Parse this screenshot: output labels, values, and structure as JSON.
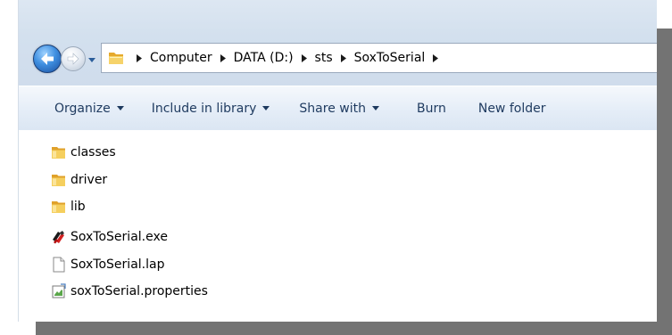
{
  "navigation": {
    "back_icon": "back-arrow-icon",
    "forward_icon": "forward-arrow-icon",
    "recent_pages_icon": "chevron-down-icon"
  },
  "address": {
    "root_icon": "folder-icon",
    "crumbs": [
      "Computer",
      "DATA (D:)",
      "sts",
      "SoxToSerial"
    ]
  },
  "toolbar": {
    "organize": "Organize",
    "include_in_library": "Include in library",
    "share_with": "Share with",
    "burn": "Burn",
    "new_folder": "New folder"
  },
  "files": [
    {
      "name": "classes",
      "icon": "folder-icon"
    },
    {
      "name": "driver",
      "icon": "folder-icon"
    },
    {
      "name": "lib",
      "icon": "folder-icon"
    },
    {
      "name": "SoxToSerial.exe",
      "icon": "exe-app-icon"
    },
    {
      "name": "SoxToSerial.lap",
      "icon": "blank-file-icon"
    },
    {
      "name": "soxToSerial.properties",
      "icon": "properties-file-icon"
    }
  ],
  "colors": {
    "shadow": "#737373",
    "chrome": "#d3e0ee",
    "folder_yellow": "#f2c64e",
    "toolbar_text": "#1e3a5f"
  }
}
